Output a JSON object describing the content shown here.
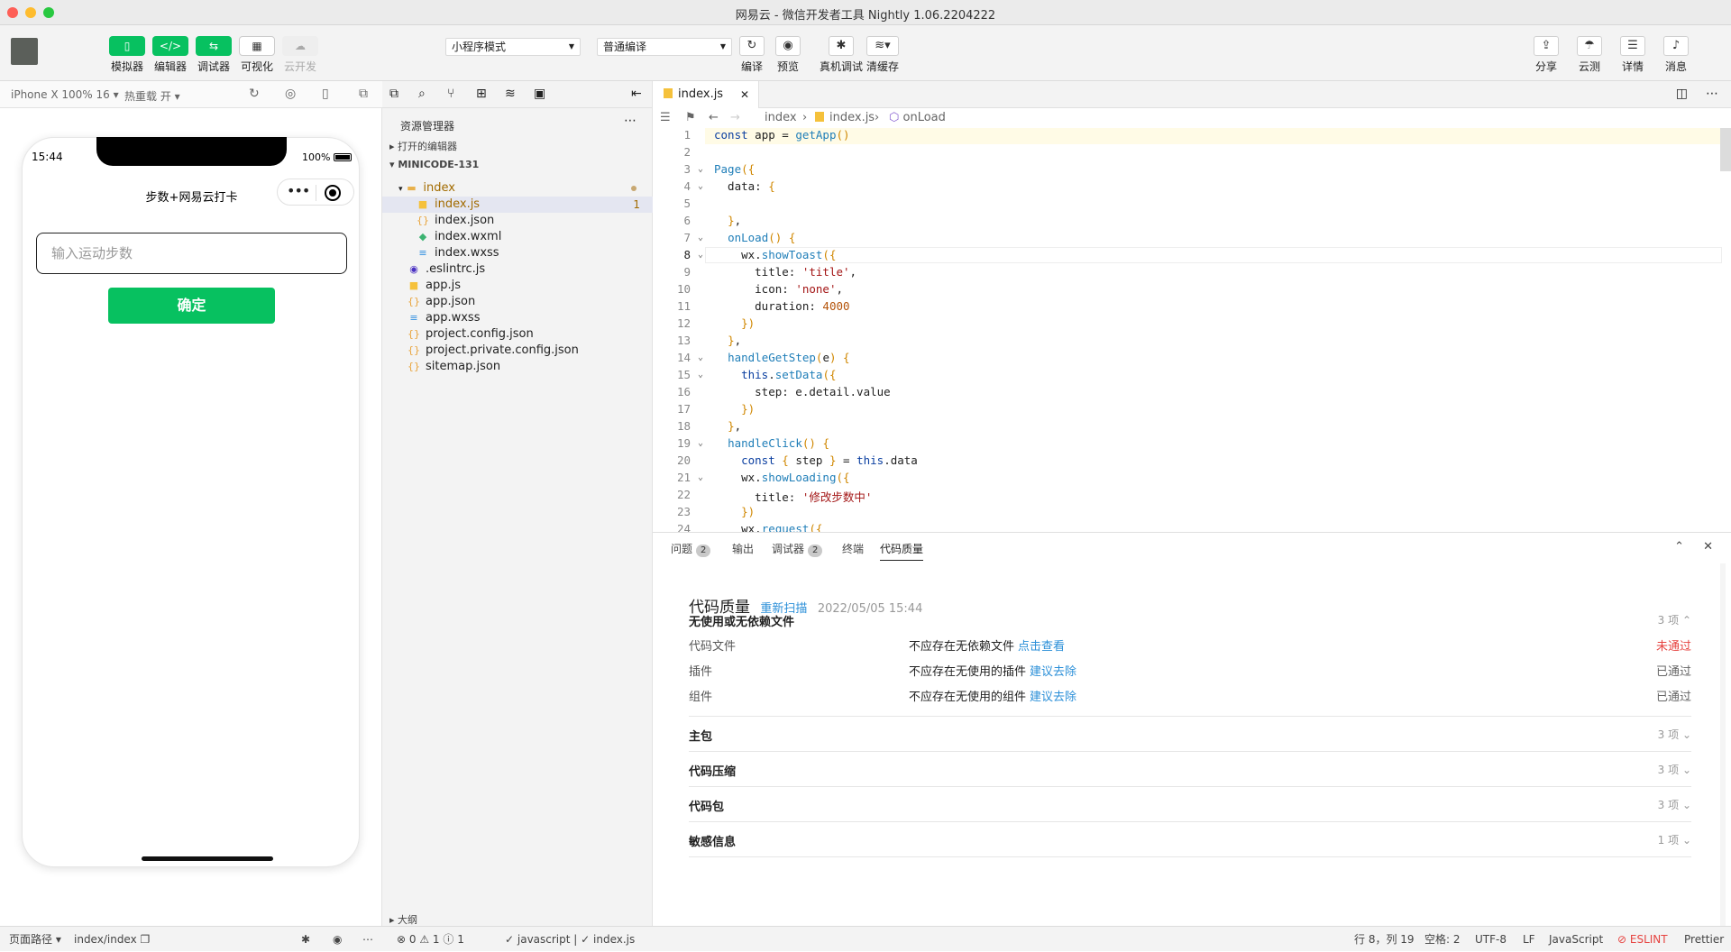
{
  "window": {
    "title": "网易云 - 微信开发者工具 Nightly 1.06.2204222"
  },
  "toolbar": {
    "simulator": "模拟器",
    "editor": "编辑器",
    "debugger": "调试器",
    "visual": "可视化",
    "cloud": "云开发",
    "mode_select": "小程序模式",
    "compile_select": "普通编译",
    "compile": "编译",
    "preview": "预览",
    "real_debug": "真机调试",
    "clear_cache": "清缓存",
    "share": "分享",
    "cloud_test": "云测",
    "details": "详情",
    "messages": "消息"
  },
  "simulator": {
    "device": "iPhone X 100% 16",
    "hot_reload": "热重载 开",
    "time": "15:44",
    "battery": "100%",
    "page_title": "步数+网易云打卡",
    "input_placeholder": "输入运动步数",
    "confirm_button": "确定"
  },
  "explorer": {
    "title": "资源管理器",
    "open_editors": "打开的编辑器",
    "project": "MINICODE-131",
    "outline": "大纲",
    "files": [
      {
        "name": "index",
        "type": "folder"
      },
      {
        "name": "index.js",
        "type": "js",
        "badge": "1"
      },
      {
        "name": "index.json",
        "type": "json"
      },
      {
        "name": "index.wxml",
        "type": "wxml"
      },
      {
        "name": "index.wxss",
        "type": "wxss"
      },
      {
        "name": ".eslintrc.js",
        "type": "eslint"
      },
      {
        "name": "app.js",
        "type": "js"
      },
      {
        "name": "app.json",
        "type": "json"
      },
      {
        "name": "app.wxss",
        "type": "wxss"
      },
      {
        "name": "project.config.json",
        "type": "json"
      },
      {
        "name": "project.private.config.json",
        "type": "json"
      },
      {
        "name": "sitemap.json",
        "type": "json"
      }
    ]
  },
  "editor": {
    "tab": "index.js",
    "breadcrumb": [
      "index",
      "index.js",
      "onLoad"
    ],
    "lines": [
      "const app = getApp()",
      "",
      "Page({",
      "  data: {",
      "",
      "  },",
      "  onLoad() {",
      "    wx.showToast({",
      "      title: 'title',",
      "      icon: 'none',",
      "      duration: 4000",
      "    })",
      "  },",
      "  handleGetStep(e) {",
      "    this.setData({",
      "      step: e.detail.value",
      "    })",
      "  },",
      "  handleClick() {",
      "    const { step } = this.data",
      "    wx.showLoading({",
      "      title: '修改步数中'",
      "    })",
      "    wx.request({"
    ]
  },
  "panel": {
    "tabs": [
      {
        "label": "问题",
        "badge": "2"
      },
      {
        "label": "输出",
        "badge": ""
      },
      {
        "label": "调试器",
        "badge": "2"
      },
      {
        "label": "终端",
        "badge": ""
      },
      {
        "label": "代码质量",
        "badge": ""
      }
    ],
    "title": "代码质量",
    "rescan": "重新扫描",
    "date": "2022/05/05 15:44",
    "sections": [
      {
        "title": "无使用或无依赖文件",
        "count": "3 项",
        "expanded": true,
        "rows": [
          {
            "name": "代码文件",
            "desc": "不应存在无依赖文件",
            "link": "点击查看",
            "status": "未通过"
          },
          {
            "name": "插件",
            "desc": "不应存在无使用的插件",
            "link": "建议去除",
            "status": "已通过"
          },
          {
            "name": "组件",
            "desc": "不应存在无使用的组件",
            "link": "建议去除",
            "status": "已通过"
          }
        ]
      },
      {
        "title": "主包",
        "count": "3 项",
        "expanded": false,
        "rows": []
      },
      {
        "title": "代码压缩",
        "count": "3 项",
        "expanded": false,
        "rows": []
      },
      {
        "title": "代码包",
        "count": "3 项",
        "expanded": false,
        "rows": []
      },
      {
        "title": "敏感信息",
        "count": "1 项",
        "expanded": false,
        "rows": []
      }
    ]
  },
  "statusbar": {
    "page_path_label": "页面路径",
    "page_path": "index/index",
    "errors": "0",
    "warnings": "1",
    "infos": "1",
    "lang_check": "javascript",
    "file_check": "index.js",
    "position": "行 8，列 19",
    "spaces": "空格: 2",
    "encoding": "UTF-8",
    "eol": "LF",
    "language": "JavaScript",
    "eslint": "ESLINT",
    "prettier": "Prettier"
  },
  "colors": {
    "accent": "#07c160",
    "link": "#2b8fd8",
    "fail": "#e64340"
  }
}
